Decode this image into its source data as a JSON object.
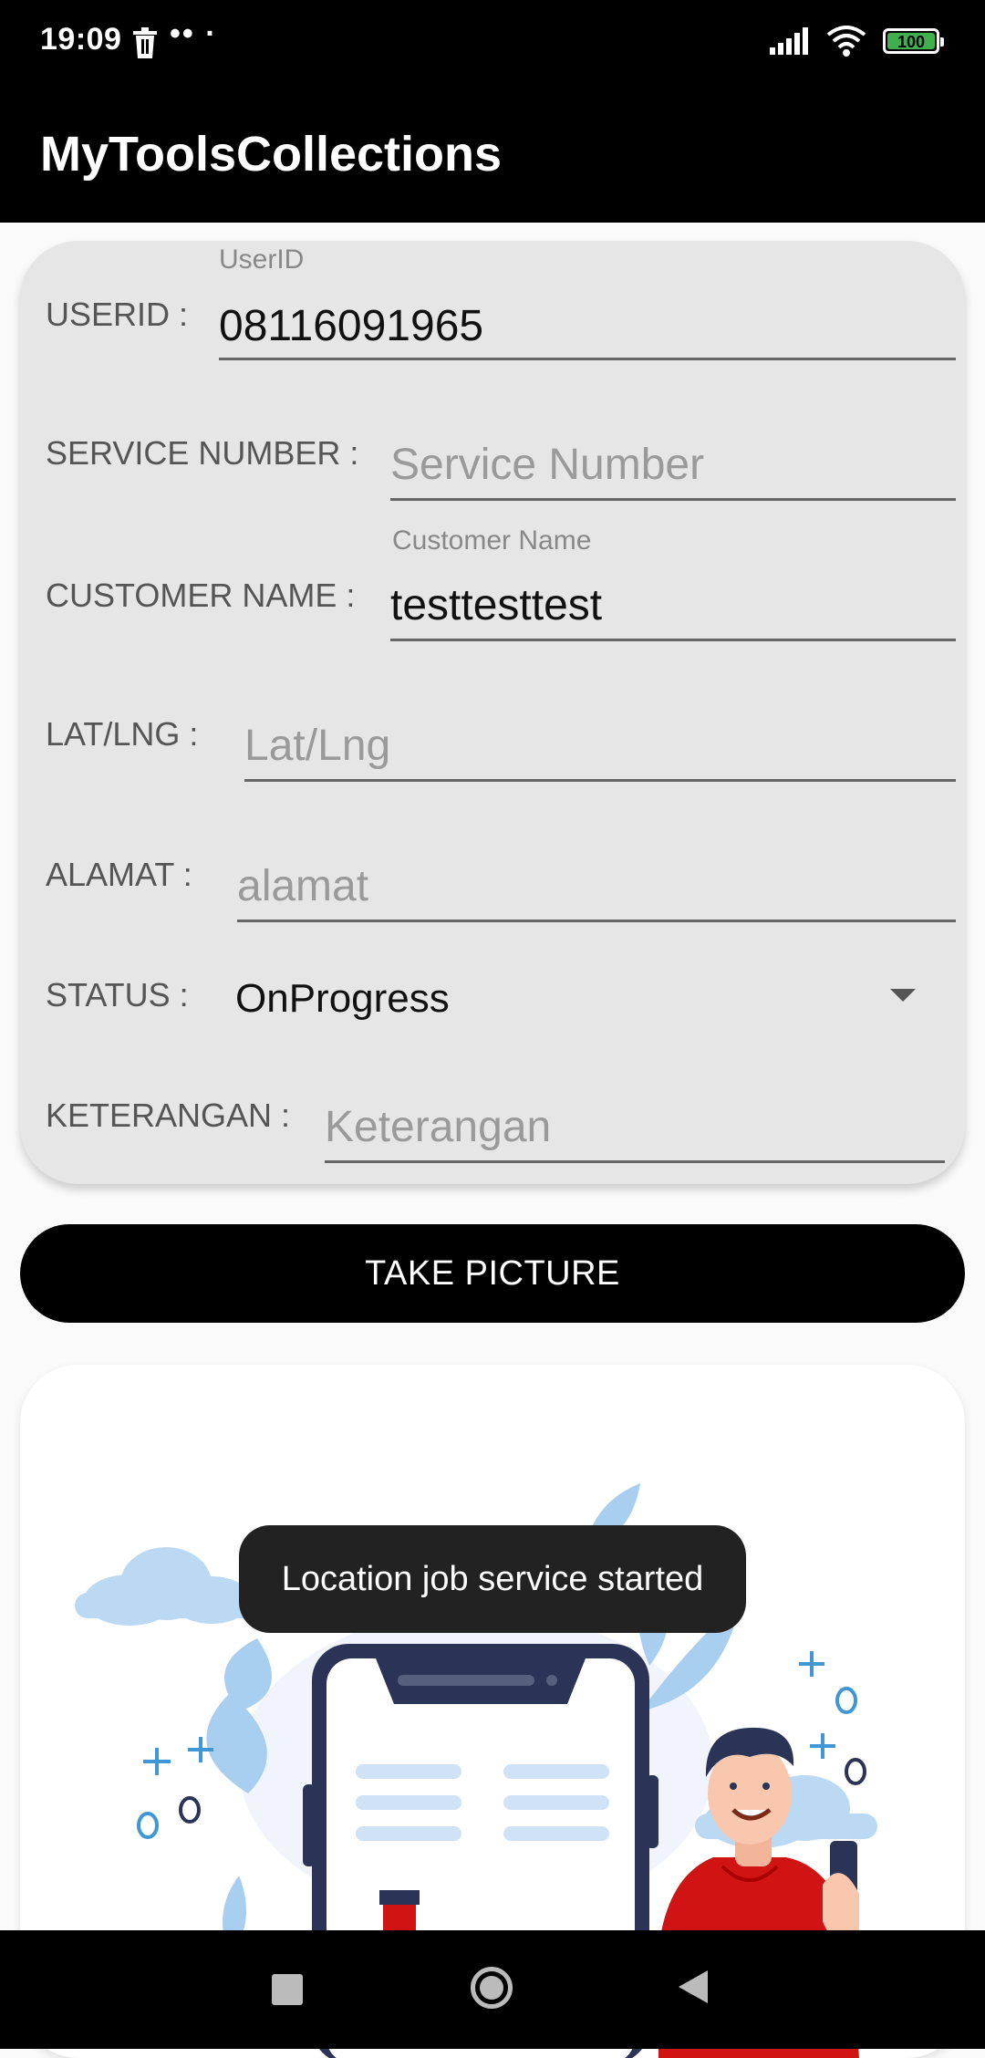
{
  "status_bar": {
    "time": "19:09",
    "dots": "•• ·",
    "battery": "100",
    "icons": [
      "trash-icon",
      "signal-icon",
      "wifi-icon",
      "battery-icon"
    ]
  },
  "app_bar": {
    "title": "MyToolsCollections"
  },
  "form": {
    "userid": {
      "label": "USERID :",
      "float_label": "UserID",
      "value": "08116091965"
    },
    "service_number": {
      "label": "SERVICE NUMBER :",
      "placeholder": "Service Number"
    },
    "customer_name": {
      "label": "CUSTOMER NAME :",
      "float_label": "Customer Name",
      "value": "testtesttest"
    },
    "lat_lng": {
      "label": "LAT/LNG :",
      "placeholder": "Lat/Lng"
    },
    "alamat": {
      "label": "ALAMAT :",
      "placeholder": "alamat"
    },
    "status": {
      "label": "STATUS :",
      "selected": "OnProgress"
    },
    "keterangan": {
      "label": "KETERANGAN :",
      "placeholder": "Keterangan"
    }
  },
  "take_picture_button": "TAKE PICTURE",
  "toast": "Location job service started",
  "colors": {
    "app_bar": "#000000",
    "form_card": "#e6e6e6",
    "button": "#000000",
    "illustration_blue": "#a9cff0",
    "illustration_navy": "#2b3457",
    "illustration_red": "#d01414"
  }
}
